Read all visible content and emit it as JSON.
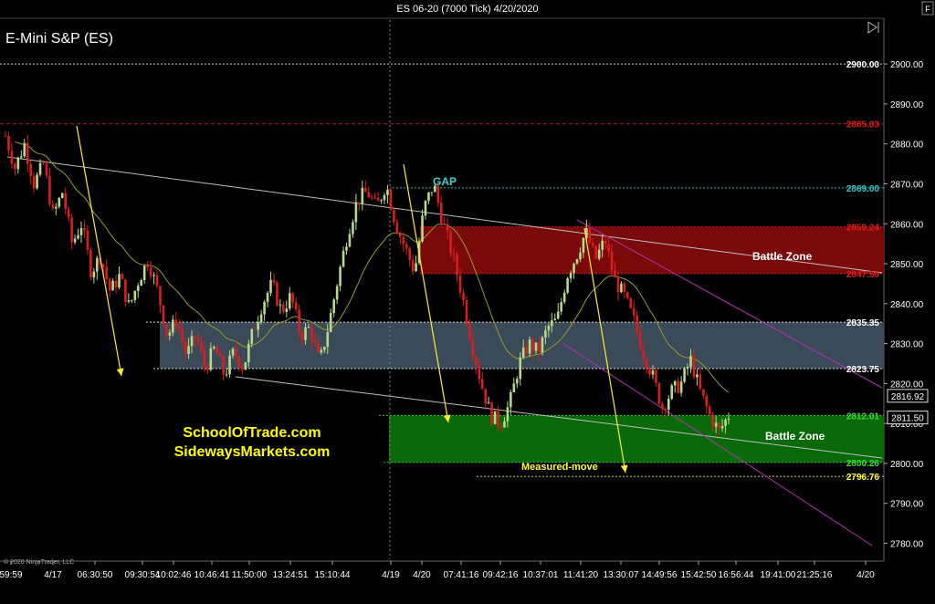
{
  "window": {
    "title": "ES 06-20 (7000 Tick)  4/20/2020",
    "f_button": "F"
  },
  "chart_data": {
    "type": "candlestick",
    "title": "E-Mini S&P (ES)",
    "instrument": "ES 06-20",
    "interval": "7000 Tick",
    "date": "4/20/2020",
    "copyright": "© 2020 NinjaTrader, LLC",
    "last_price": "2811.50",
    "cursor_price": "2816.92",
    "y_axis": {
      "ticks": [
        "2780.00",
        "2790.00",
        "2800.00",
        "2810.00",
        "2820.00",
        "2830.00",
        "2840.00",
        "2850.00",
        "2860.00",
        "2870.00",
        "2880.00",
        "2890.00",
        "2900.00"
      ],
      "ylim": [
        2776,
        2911
      ]
    },
    "x_axis": {
      "ticks": [
        "59:59",
        "4/17",
        "06:30:50",
        "09:30:54",
        "10:02:46",
        "10:46:41",
        "11:50:00",
        "13:24:51",
        "15:10:44",
        "4/19",
        "4/20",
        "07:41:16",
        "09:42:16",
        "10:37:01",
        "11:41:20",
        "13:30:07",
        "14:49:56",
        "15:42:50",
        "16:56:44",
        "19:41:00",
        "21:25:16",
        "4/20"
      ]
    },
    "levels": [
      {
        "value": 2900.0,
        "label": "2900.00",
        "color": "#ffffff"
      },
      {
        "value": 2885.03,
        "label": "2885.03",
        "color": "#e31b1b"
      },
      {
        "value": 2869.0,
        "label": "2869.00",
        "color": "#33cccc"
      },
      {
        "value": 2859.24,
        "label": "2859.24",
        "color": "#e31b1b"
      },
      {
        "value": 2847.5,
        "label": "2847.50",
        "color": "#e31b1b"
      },
      {
        "value": 2835.35,
        "label": "2835.35",
        "color": "#ffffff"
      },
      {
        "value": 2823.75,
        "label": "2823.75",
        "color": "#ffffff"
      },
      {
        "value": 2812.01,
        "label": "2812.01",
        "color": "#33dd33"
      },
      {
        "value": 2800.26,
        "label": "2800.26",
        "color": "#33dd33"
      },
      {
        "value": 2796.76,
        "label": "2796.76",
        "color": "#ffff33"
      }
    ],
    "zones": [
      {
        "name": "red-zone",
        "top": 2859.24,
        "bottom": 2847.5,
        "color": "#7a0a0a",
        "label": "Battle Zone"
      },
      {
        "name": "blue-zone",
        "top": 2835.35,
        "bottom": 2823.75,
        "color": "#3a4a58",
        "label": ""
      },
      {
        "name": "green-zone",
        "top": 2812.01,
        "bottom": 2800.26,
        "color": "#0a6a0a",
        "label": "Battle Zone"
      }
    ],
    "annotations": {
      "gap": "GAP",
      "measured_move": "Measured-move",
      "website1": "SchoolOfTrade.com",
      "website2": "SidewaysMarkets.com"
    },
    "price_path": [
      2882,
      2874,
      2880,
      2870,
      2875,
      2862,
      2868,
      2855,
      2860,
      2848,
      2852,
      2843,
      2847,
      2839,
      2846,
      2851,
      2843,
      2832,
      2836,
      2827,
      2832,
      2824,
      2829,
      2822,
      2828,
      2824,
      2833,
      2840,
      2845,
      2838,
      2842,
      2832,
      2834,
      2825,
      2835,
      2847,
      2858,
      2866,
      2868,
      2864,
      2870,
      2860,
      2854,
      2848,
      2864,
      2870,
      2860,
      2852,
      2842,
      2830,
      2820,
      2812,
      2810,
      2815,
      2825,
      2830,
      2828,
      2834,
      2836,
      2847,
      2852,
      2858,
      2851,
      2856,
      2846,
      2842,
      2836,
      2828,
      2822,
      2814,
      2818,
      2820,
      2826,
      2818,
      2812,
      2808,
      2812
    ]
  },
  "colors": {
    "background": "#000000",
    "text": "#ffffff",
    "candle_up": "#b7d98a",
    "candle_down": "#d81e1e",
    "ma": "#9a9a2a",
    "trend_white": "#bfbfbf",
    "trend_magenta": "#b030b0",
    "arrow_yellow": "#ffeb3b",
    "gap_cyan": "#40d0d0",
    "website_yellow": "#ffff00"
  }
}
